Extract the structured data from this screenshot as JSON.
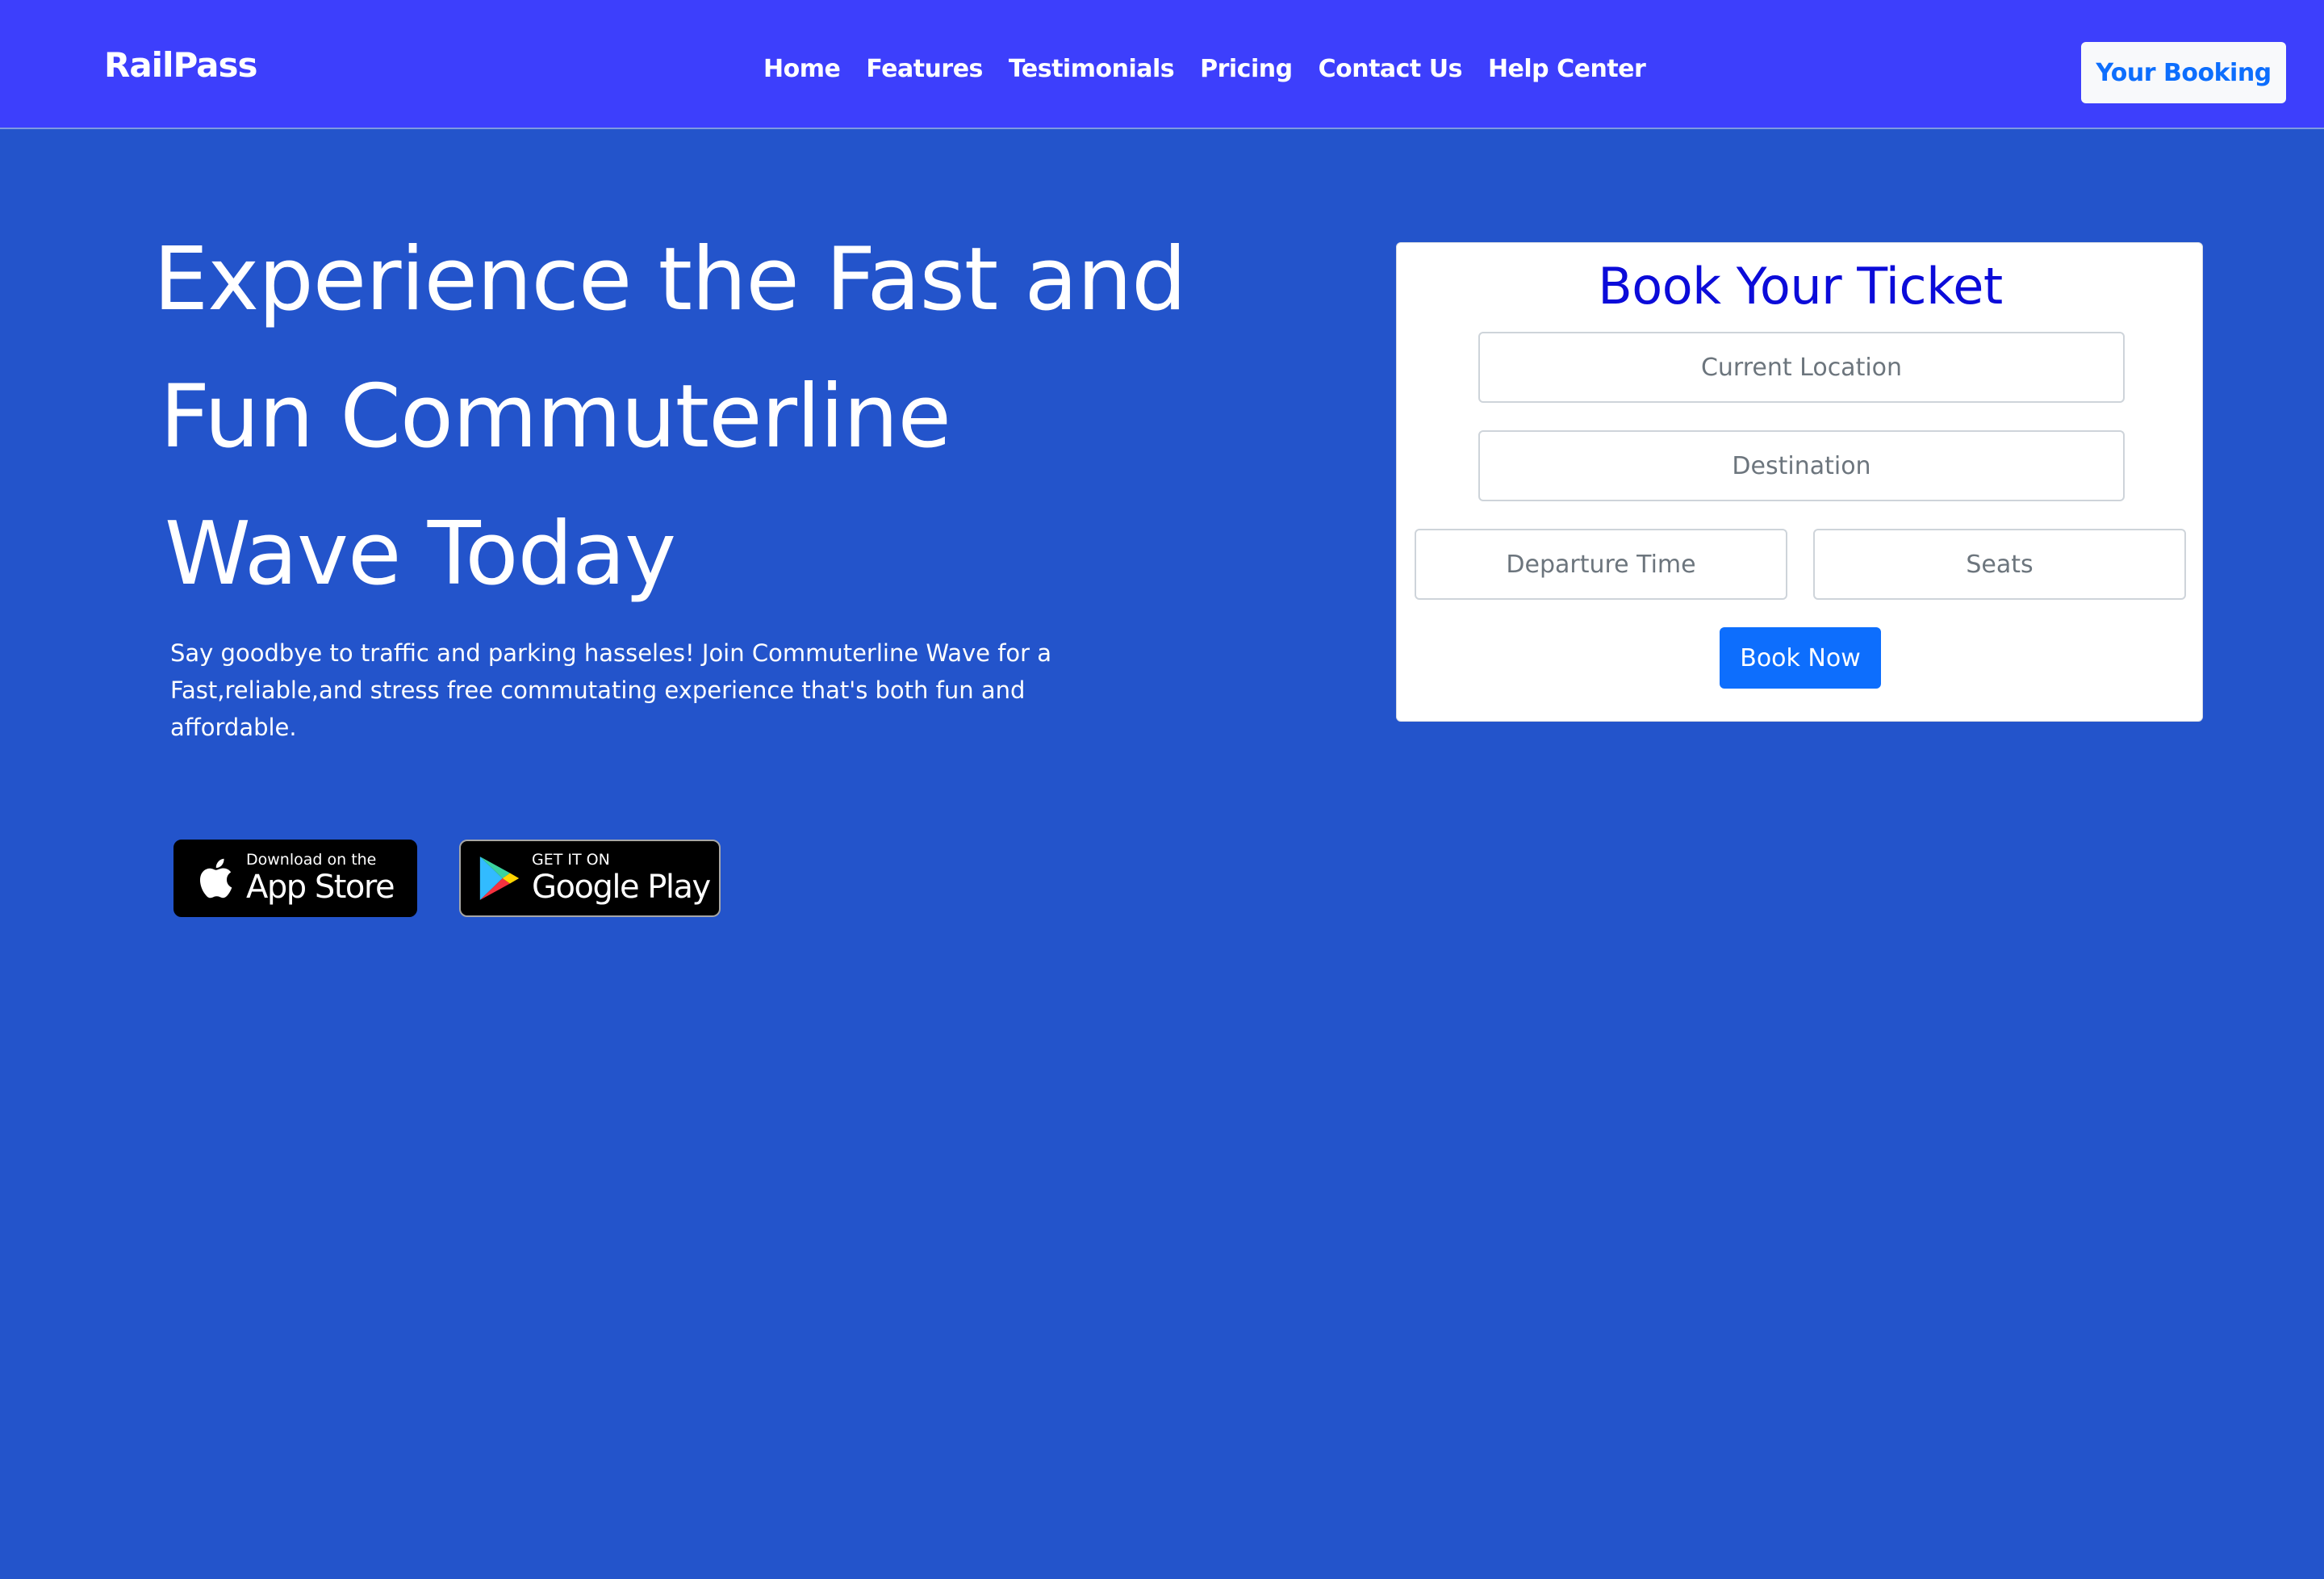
{
  "navbar": {
    "brand": "RailPass",
    "links": [
      "Home",
      "Features",
      "Testimonials",
      "Pricing",
      "Contact Us",
      "Help Center"
    ],
    "booking_button": "Your Booking"
  },
  "hero": {
    "title_lines": [
      "Experience the Fast and",
      "Fun Commuterline",
      "Wave Today"
    ],
    "description": "Say goodbye to traffic and parking hasseles! Join Commuterline Wave for a Fast,reliable,and stress free commutating experience that's both fun and affordable."
  },
  "badges": {
    "app_store": {
      "small": "Download on the",
      "big": "App Store",
      "icon": "apple-icon"
    },
    "google_play": {
      "small": "GET IT ON",
      "big": "Google Play",
      "icon": "google-play-icon"
    }
  },
  "booking_form": {
    "title": "Book Your Ticket",
    "current_location_placeholder": "Current Location",
    "destination_placeholder": "Destination",
    "departure_placeholder": "Departure Time",
    "seats_placeholder": "Seats",
    "submit_label": "Book Now"
  },
  "colors": {
    "navbar_bg": "#3d3ffc",
    "page_bg": "#2354cb",
    "primary": "#0d6efd",
    "ticket_title": "#0b0bd9"
  }
}
